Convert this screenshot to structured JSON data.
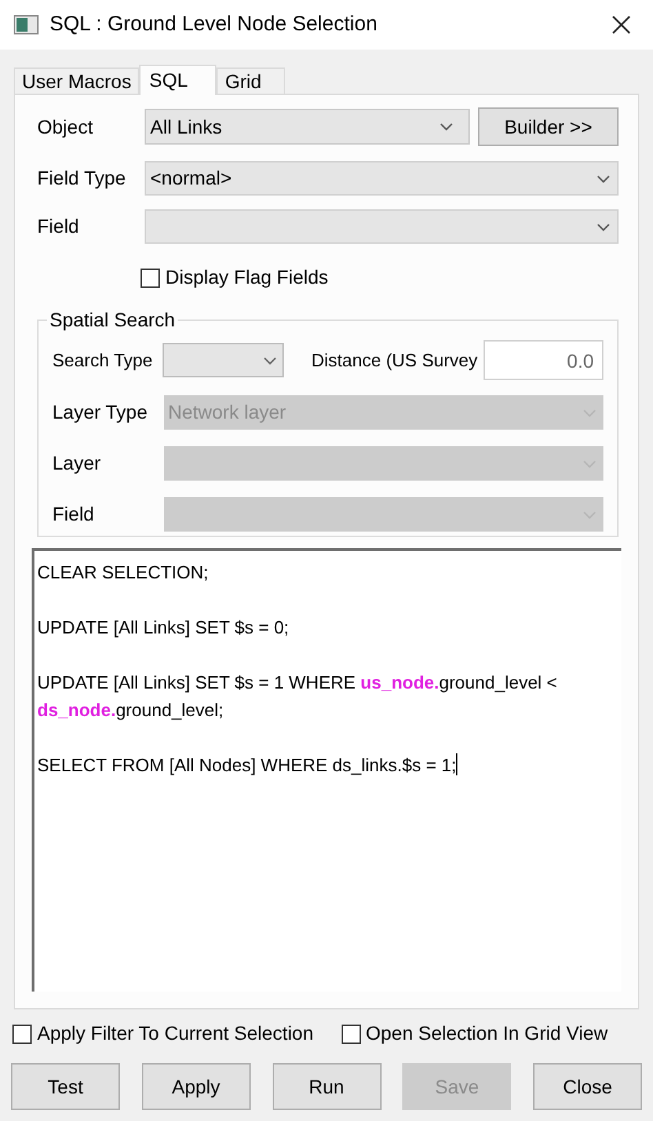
{
  "window": {
    "title": "SQL : Ground Level Node Selection"
  },
  "tabs": [
    {
      "label": "User Macros",
      "selected": false
    },
    {
      "label": "SQL",
      "selected": true
    },
    {
      "label": "Grid",
      "selected": false
    }
  ],
  "object": {
    "label": "Object",
    "value": "All Links"
  },
  "builder_button": {
    "label": "Builder >>"
  },
  "field_type": {
    "label": "Field Type",
    "value": "<normal>"
  },
  "field": {
    "label": "Field"
  },
  "display_flag_fields": {
    "label": "Display Flag Fields",
    "checked": false
  },
  "spatial_search": {
    "title": "Spatial Search",
    "search_type": {
      "label": "Search Type"
    },
    "distance": {
      "label": "Distance (US Survey",
      "value": "0.0"
    },
    "rows": [
      {
        "label": "Layer Type",
        "value": "Network layer",
        "disabled": true
      },
      {
        "label": "Layer",
        "disabled": true
      },
      {
        "label": "Field",
        "disabled": true
      }
    ]
  },
  "sql_statements": [
    [
      {
        "text": "CLEAR SELECTION;",
        "kind": "plain"
      }
    ],
    [
      {
        "text": "UPDATE [All Links] SET $s = 0;",
        "kind": "plain"
      }
    ],
    [
      {
        "text": "UPDATE [All Links] SET $s = 1 WHERE ",
        "kind": "plain"
      },
      {
        "text": "us_node.",
        "kind": "object"
      },
      {
        "text": "ground_level < ",
        "kind": "plain"
      },
      {
        "text": "ds_node.",
        "kind": "object"
      },
      {
        "text": "ground_level;",
        "kind": "plain"
      }
    ],
    [
      {
        "text": "SELECT FROM [All Nodes] WHERE ds_links.$s = 1;",
        "kind": "plain"
      }
    ]
  ],
  "options": [
    {
      "label": "Apply Filter To Current Selection",
      "checked": false
    },
    {
      "label": "Open Selection In Grid View",
      "checked": false
    }
  ],
  "buttons": [
    {
      "label": "Test",
      "disabled": false
    },
    {
      "label": "Apply",
      "disabled": false
    },
    {
      "label": "Run",
      "disabled": false
    },
    {
      "label": "Save",
      "disabled": true
    },
    {
      "label": "Close",
      "disabled": false
    }
  ]
}
